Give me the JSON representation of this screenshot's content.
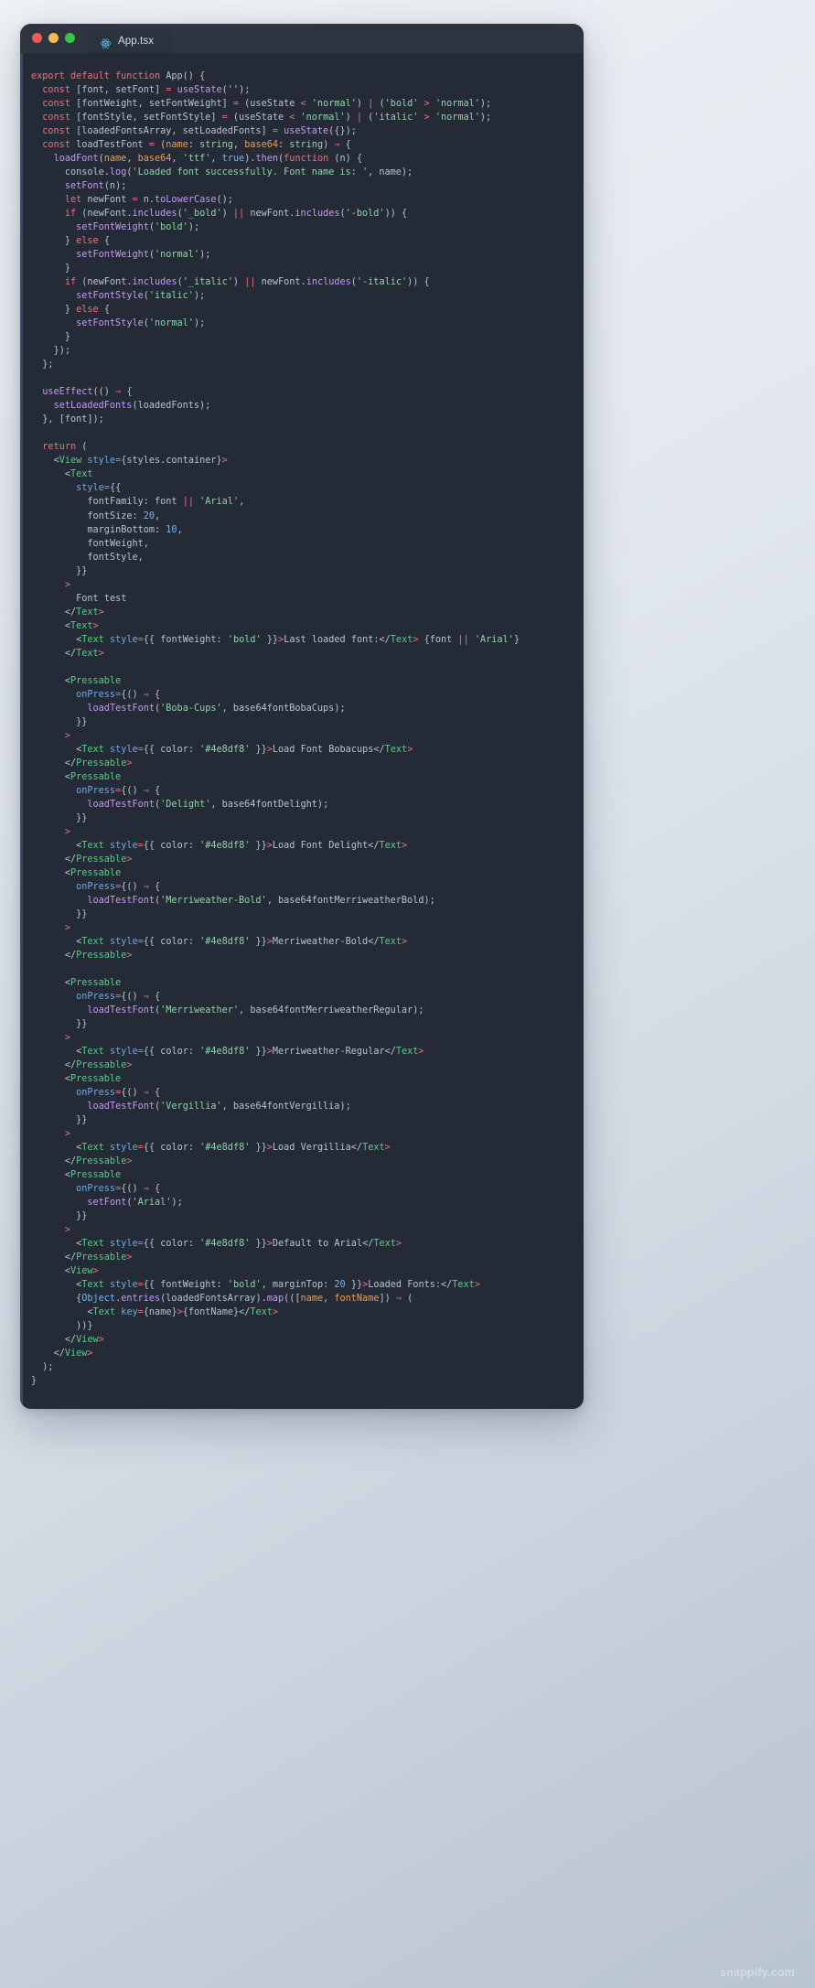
{
  "window": {
    "traffic_lights": [
      {
        "name": "close",
        "color": "#f2595b"
      },
      {
        "name": "minimize",
        "color": "#f4bd4f"
      },
      {
        "name": "maximize",
        "color": "#33c748"
      }
    ],
    "tab": {
      "icon": "react-logo-icon",
      "label": "App.tsx"
    }
  },
  "watermark": "snappify.com",
  "theme": {
    "background": "#252b36",
    "titlebar": "#2e3440",
    "keyword": "#e5737d",
    "variable": "#7bb3e8",
    "function": "#c39bf0",
    "string": "#8fd4a8",
    "jsx_tag": "#5ec98a",
    "jsx_attr": "#6fa8e0",
    "param": "#e0a060",
    "plain": "#b9c2cf"
  },
  "editor": {
    "language": "tsx",
    "filename": "App.tsx",
    "code_lines": [
      "export default function App() {",
      "  const [font, setFont] = useState('');",
      "  const [fontWeight, setFontWeight] = (useState < 'normal') | ('bold' > 'normal');",
      "  const [fontStyle, setFontStyle] = (useState < 'normal') | ('italic' > 'normal');",
      "  const [loadedFontsArray, setLoadedFonts] = useState({});",
      "  const loadTestFont = (name: string, base64: string) => {",
      "    loadFont(name, base64, 'ttf', true).then(function (n) {",
      "      console.log('Loaded font successfully. Font name is: ', name);",
      "      setFont(n);",
      "      let newFont = n.toLowerCase();",
      "      if (newFont.includes('_bold') || newFont.includes('-bold')) {",
      "        setFontWeight('bold');",
      "      } else {",
      "        setFontWeight('normal');",
      "      }",
      "      if (newFont.includes('_italic') || newFont.includes('-italic')) {",
      "        setFontStyle('italic');",
      "      } else {",
      "        setFontStyle('normal');",
      "      }",
      "    });",
      "  };",
      "",
      "  useEffect(() => {",
      "    setLoadedFonts(loadedFonts);",
      "  }, [font]);",
      "",
      "  return (",
      "    <View style={styles.container}>",
      "      <Text",
      "        style={{",
      "          fontFamily: font || 'Arial',",
      "          fontSize: 20,",
      "          marginBottom: 10,",
      "          fontWeight,",
      "          fontStyle,",
      "        }}",
      "      >",
      "        Font test",
      "      </Text>",
      "      <Text>",
      "        <Text style={{ fontWeight: 'bold' }}>Last loaded font:</Text> {font || 'Arial'}",
      "      </Text>",
      "",
      "      <Pressable",
      "        onPress={() => {",
      "          loadTestFont('Boba-Cups', base64fontBobaCups);",
      "        }}",
      "      >",
      "        <Text style={{ color: '#4e8df8' }}>Load Font Bobacups</Text>",
      "      </Pressable>",
      "      <Pressable",
      "        onPress={() => {",
      "          loadTestFont('Delight', base64fontDelight);",
      "        }}",
      "      >",
      "        <Text style={{ color: '#4e8df8' }}>Load Font Delight</Text>",
      "      </Pressable>",
      "      <Pressable",
      "        onPress={() => {",
      "          loadTestFont('Merriweather-Bold', base64fontMerriweatherBold);",
      "        }}",
      "      >",
      "        <Text style={{ color: '#4e8df8' }}>Merriweather-Bold</Text>",
      "      </Pressable>",
      "",
      "      <Pressable",
      "        onPress={() => {",
      "          loadTestFont('Merriweather', base64fontMerriweatherRegular);",
      "        }}",
      "      >",
      "        <Text style={{ color: '#4e8df8' }}>Merriweather-Regular</Text>",
      "      </Pressable>",
      "      <Pressable",
      "        onPress={() => {",
      "          loadTestFont('Vergillia', base64fontVergillia);",
      "        }}",
      "      >",
      "        <Text style={{ color: '#4e8df8' }}>Load Vergillia</Text>",
      "      </Pressable>",
      "      <Pressable",
      "        onPress={() => {",
      "          setFont('Arial');",
      "        }}",
      "      >",
      "        <Text style={{ color: '#4e8df8' }}>Default to Arial</Text>",
      "      </Pressable>",
      "      <View>",
      "        <Text style={{ fontWeight: 'bold', marginTop: 20 }}>Loaded Fonts:</Text>",
      "        {Object.entries(loadedFontsArray).map(([name, fontName]) => (",
      "          <Text key={name}>{fontName}</Text>",
      "        ))}",
      "      </View>",
      "    </View>",
      "  );",
      "}"
    ],
    "highlight_rules": {
      "keywords": [
        "export",
        "default",
        "function",
        "const",
        "let",
        "if",
        "else",
        "return"
      ],
      "jsx_tags": [
        "View",
        "Text",
        "Pressable"
      ],
      "jsx_attrs": [
        "style",
        "onPress",
        "key"
      ],
      "functions": [
        "useState",
        "useEffect",
        "loadFont",
        "loadTestFont",
        "setFont",
        "setFontWeight",
        "setFontStyle",
        "setLoadedFonts",
        "log",
        "toLowerCase",
        "includes",
        "then",
        "entries",
        "map"
      ],
      "params": [
        "name",
        "base64",
        "fontName"
      ],
      "types": [
        "string"
      ],
      "numbers": [
        "20",
        "10"
      ],
      "strings": [
        "''",
        "'normal'",
        "'bold'",
        "'italic'",
        "'ttf'",
        "'Loaded font successfully. Font name is: '",
        "'_bold'",
        "'-bold'",
        "'_italic'",
        "'-italic'",
        "'Arial'",
        "'Boba-Cups'",
        "'Delight'",
        "'Merriweather-Bold'",
        "'Merriweather'",
        "'Vergillia'",
        "'#4e8df8'"
      ],
      "accent_color_literal": "#4e8df8"
    }
  }
}
